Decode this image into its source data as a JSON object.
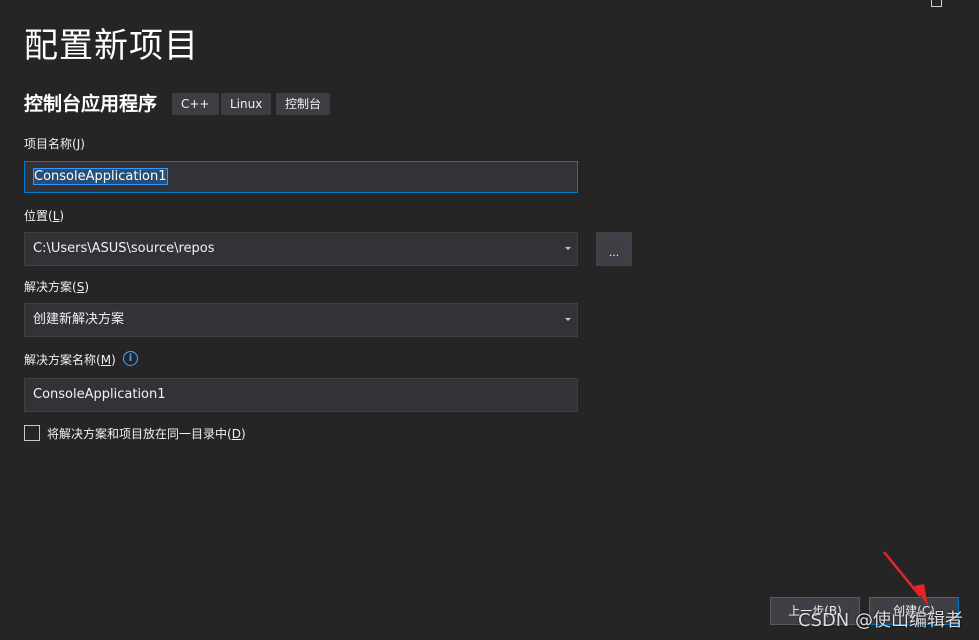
{
  "page": {
    "title": "配置新项目",
    "subtitle": "控制台应用程序",
    "tags": [
      "C++",
      "Linux",
      "控制台"
    ]
  },
  "project_name": {
    "label": "项目名称",
    "accel": "J",
    "value": "ConsoleApplication1"
  },
  "location": {
    "label": "位置",
    "accel": "L",
    "value": "C:\\Users\\ASUS\\source\\repos",
    "browse_label": "..."
  },
  "solution": {
    "label": "解决方案",
    "accel": "S",
    "value": "创建新解决方案"
  },
  "solution_name": {
    "label": "解决方案名称",
    "accel": "M",
    "value": "ConsoleApplication1",
    "info_glyph": "i"
  },
  "same_dir": {
    "label": "将解决方案和项目放在同一目录中",
    "accel": "D",
    "checked": false
  },
  "footer": {
    "back_label": "上一步(B)",
    "create_label": "创建(C)"
  },
  "watermark": "CSDN @使山编辑者",
  "colors": {
    "background": "#252526",
    "accent": "#007acc",
    "annotation": "#e8232a"
  }
}
